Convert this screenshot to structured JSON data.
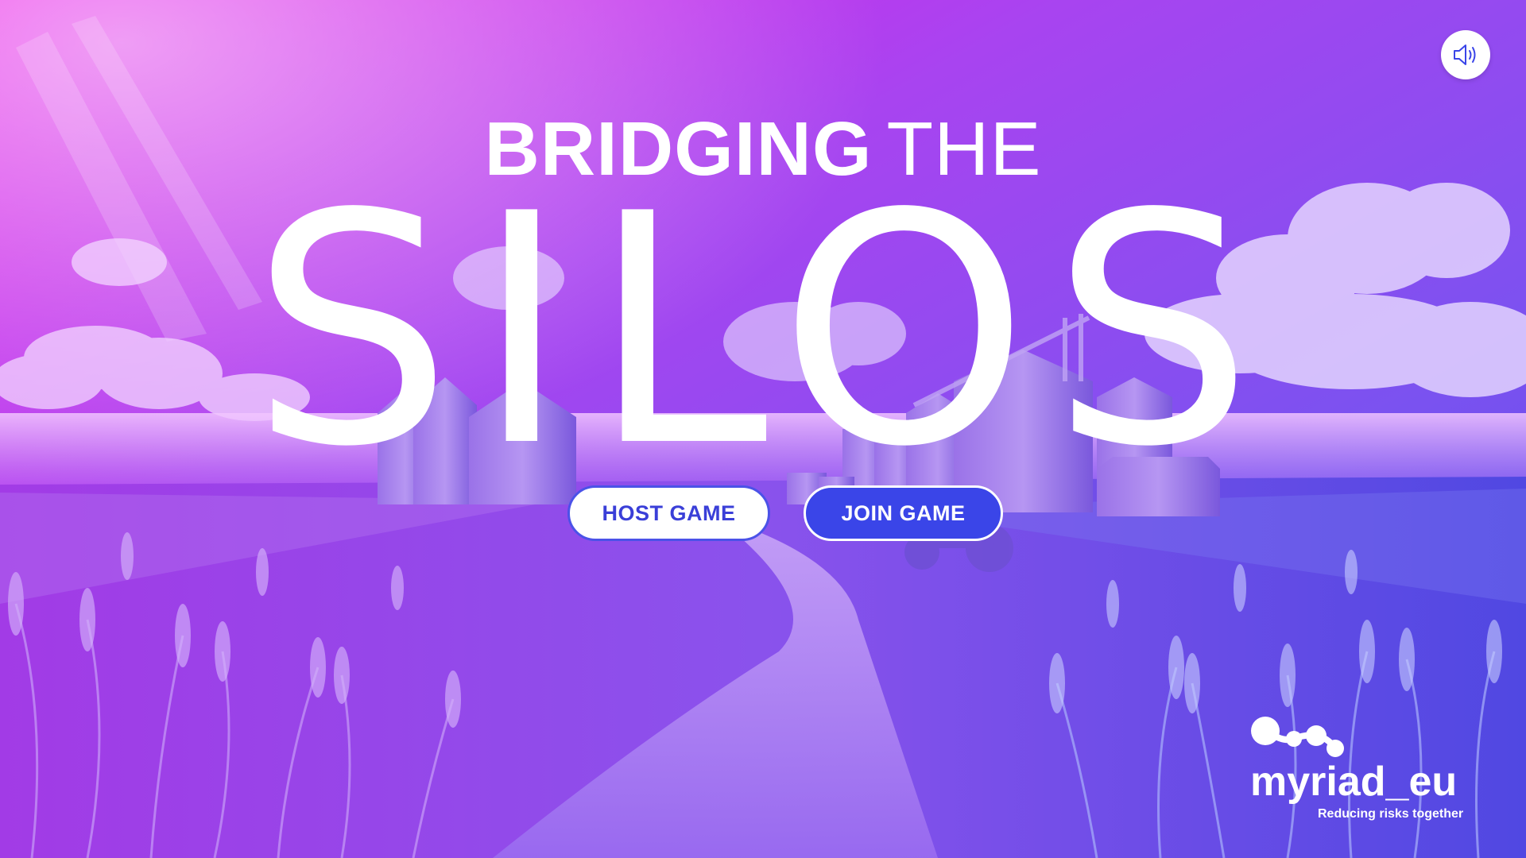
{
  "title": {
    "line1_bold": "BRIDGING",
    "line1_light": "THE",
    "line2": "SILOS"
  },
  "buttons": {
    "host_label": "HOST GAME",
    "join_label": "JOIN GAME"
  },
  "sound": {
    "icon": "speaker-volume-icon"
  },
  "logo": {
    "wordmark": "myriad_eu",
    "tagline": "Reducing risks together"
  },
  "colors": {
    "gradient_start": "#e020e8",
    "gradient_end": "#5a3fe0",
    "button_blue": "#3a45e8",
    "button_text_blue": "#3a3fd8",
    "white": "#ffffff"
  }
}
